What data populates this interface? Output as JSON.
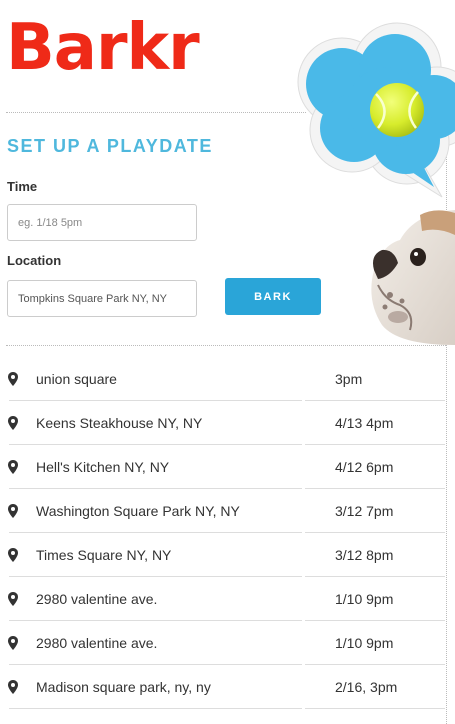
{
  "app": {
    "logo": "Barkr"
  },
  "form": {
    "title": "SET UP A PLAYDATE",
    "time_label": "Time",
    "time_placeholder": "eg. 1/18 5pm",
    "location_label": "Location",
    "location_value": "Tompkins Square Park NY, NY",
    "submit_label": "BARK"
  },
  "icons": {
    "pin": "map-pin-icon",
    "bubble": "tennis-ball-icon"
  },
  "colors": {
    "logo": "#ef2a18",
    "title": "#4fb8dd",
    "button": "#2aa5d8",
    "bubble": "#4ab9e8",
    "ball": "#d7ec2c"
  },
  "playdates": [
    {
      "place": "union square",
      "time": "3pm"
    },
    {
      "place": "Keens Steakhouse NY, NY",
      "time": "4/13 4pm"
    },
    {
      "place": "Hell's Kitchen NY, NY",
      "time": "4/12 6pm"
    },
    {
      "place": "Washington Square Park NY, NY",
      "time": "3/12 7pm"
    },
    {
      "place": "Times Square NY, NY",
      "time": "3/12 8pm"
    },
    {
      "place": "2980 valentine ave.",
      "time": "1/10 9pm"
    },
    {
      "place": "2980 valentine ave.",
      "time": "1/10 9pm"
    },
    {
      "place": "Madison square park, ny, ny",
      "time": "2/16, 3pm"
    }
  ]
}
